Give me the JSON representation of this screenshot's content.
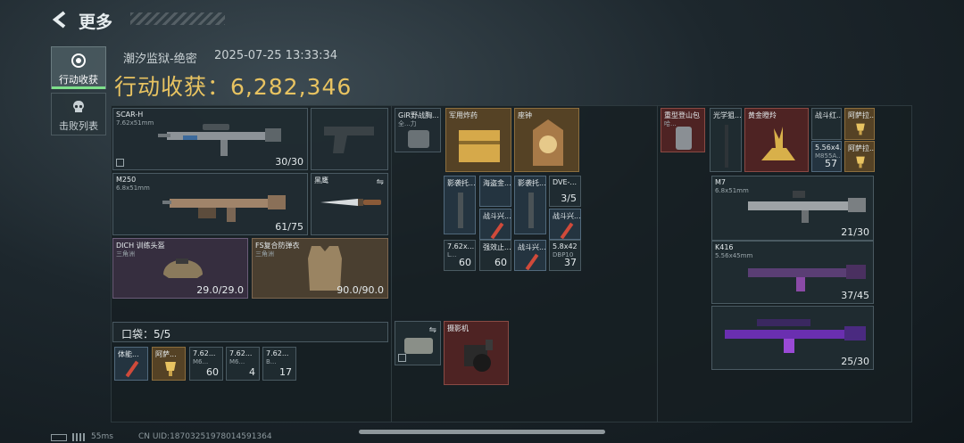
{
  "header": {
    "title": "更多"
  },
  "side_tabs": [
    {
      "label": "行动收获",
      "active": true
    },
    {
      "label": "击败列表",
      "active": false
    }
  ],
  "meta": {
    "location": "潮汐监狱-绝密",
    "datetime": "2025-07-25 13:33:34"
  },
  "income": {
    "label": "行动收获：",
    "value": "6,282,346"
  },
  "loadout": [
    {
      "name": "SCAR-H",
      "sub": "7.62x51mm",
      "count": "30/30"
    },
    {
      "name": "M250",
      "sub": "6.8x51mm",
      "count": "61/75"
    },
    {
      "name": "黑鹰",
      "sub": "",
      "count": ""
    },
    {
      "name": "DICH 训练头盔",
      "sub": "三角洲",
      "count": "29.0/29.0"
    },
    {
      "name": "FS复合防弹衣",
      "sub": "三角洲",
      "count": "90.0/90.0"
    }
  ],
  "pocket": {
    "label": "口袋：5/5",
    "items": [
      {
        "name": "体能...",
        "count": ""
      },
      {
        "name": "阿萨...",
        "count": ""
      },
      {
        "name": "7.62...",
        "sub": "M6...",
        "count": "60"
      },
      {
        "name": "7.62...",
        "sub": "M6...",
        "count": "4"
      },
      {
        "name": "7.62...",
        "sub": "B...",
        "count": "17"
      }
    ]
  },
  "backpack_top": [
    {
      "name": "GiR野战胸...",
      "sub": "全...力",
      "count": ""
    },
    {
      "name": "军用炸药",
      "count": ""
    },
    {
      "name": "座钟",
      "count": ""
    }
  ],
  "backpack_grid": [
    {
      "name": "影袭托...",
      "count": ""
    },
    {
      "name": "海盗金...",
      "count": ""
    },
    {
      "name": "影袭托...",
      "count": ""
    },
    {
      "name": "DVE-...",
      "count": "3/5"
    },
    {
      "name": "战斗兴...",
      "count": ""
    },
    {
      "name": "战斗兴...",
      "count": ""
    },
    {
      "name": "7.62x...",
      "sub": "L...",
      "count": "60"
    },
    {
      "name": "强效止...",
      "count": "60"
    },
    {
      "name": "战斗兴...",
      "count": ""
    },
    {
      "name": "5.8x42",
      "sub": "DBP10",
      "count": "37"
    }
  ],
  "backpack_bottom": [
    {
      "name": "",
      "count": ""
    },
    {
      "name": "摄影机",
      "count": ""
    }
  ],
  "safebox": [
    {
      "name": "重型登山包",
      "sub": "哈...",
      "count": ""
    },
    {
      "name": "光学狙...",
      "count": ""
    },
    {
      "name": "黄金瞪羚",
      "count": ""
    },
    {
      "name": "战斗红...",
      "count": ""
    },
    {
      "name": "阿萨拉...",
      "count": ""
    },
    {
      "name": "5.56x4...",
      "sub": "M855A...",
      "count": "57"
    },
    {
      "name": "阿萨拉...",
      "count": ""
    }
  ],
  "rifles": [
    {
      "name": "M7",
      "sub": "6.8x51mm",
      "count": "21/30"
    },
    {
      "name": "K416",
      "sub": "5.56x45mm",
      "count": "37/45"
    },
    {
      "name": "",
      "sub": "",
      "count": "25/30"
    }
  ],
  "status_bar": {
    "ping": "55ms",
    "uid": "CN UID:187032519780145913​64"
  },
  "colors": {
    "accent_gold": "#e8c361",
    "active_green": "#7de08a"
  }
}
